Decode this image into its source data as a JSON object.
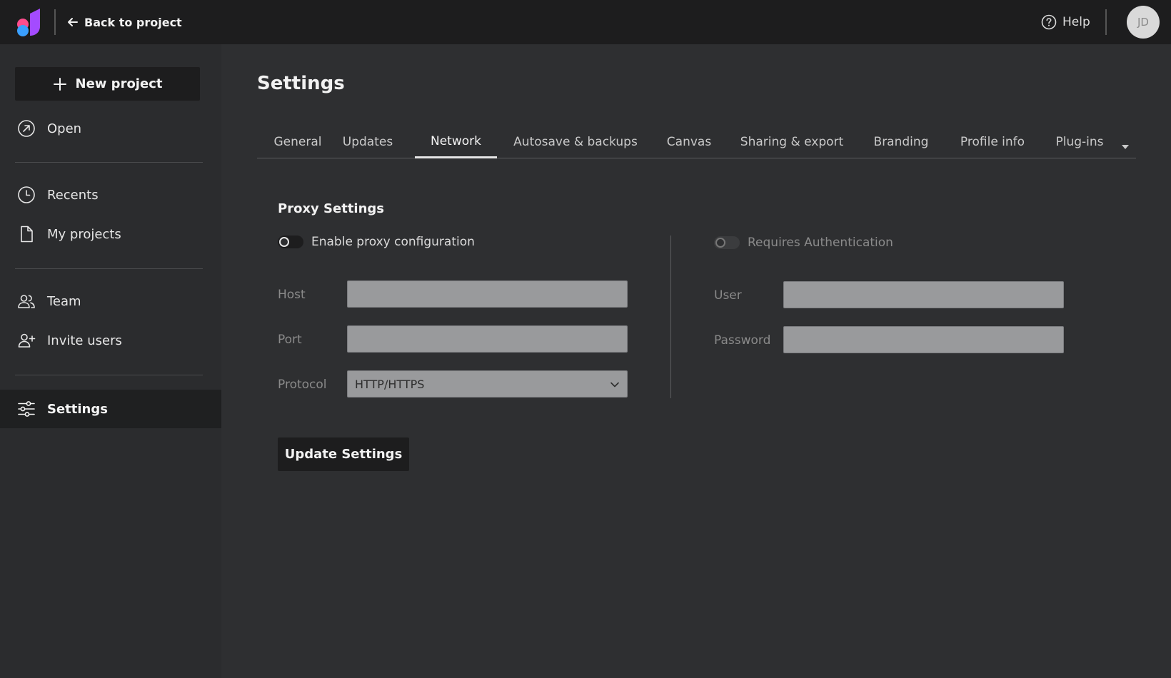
{
  "topbar": {
    "back_label": "Back to project",
    "help_label": "Help",
    "avatar_initials": "JD"
  },
  "sidebar": {
    "new_project_label": "New project",
    "items": [
      {
        "label": "Open",
        "icon": "open-arrow-icon"
      },
      {
        "label": "Recents",
        "icon": "clock-icon"
      },
      {
        "label": "My projects",
        "icon": "file-icon"
      },
      {
        "label": "Team",
        "icon": "team-icon"
      },
      {
        "label": "Invite users",
        "icon": "add-user-icon"
      },
      {
        "label": "Settings",
        "icon": "sliders-icon",
        "active": true
      }
    ]
  },
  "main": {
    "title": "Settings",
    "tabs": [
      {
        "label": "General"
      },
      {
        "label": "Updates"
      },
      {
        "label": "Network",
        "active": true
      },
      {
        "label": "Autosave & backups"
      },
      {
        "label": "Canvas"
      },
      {
        "label": "Sharing & export"
      },
      {
        "label": "Branding"
      },
      {
        "label": "Profile info"
      },
      {
        "label": "Plug-ins"
      }
    ],
    "proxy": {
      "section_title": "Proxy Settings",
      "enable_label": "Enable proxy configuration",
      "enable_on": false,
      "auth_label": "Requires Authentication",
      "auth_on": false,
      "host_label": "Host",
      "host_value": "",
      "port_label": "Port",
      "port_value": "",
      "protocol_label": "Protocol",
      "protocol_value": "HTTP/HTTPS",
      "user_label": "User",
      "user_value": "",
      "password_label": "Password",
      "password_value": ""
    },
    "update_button_label": "Update Settings"
  },
  "colors": {
    "background": "#2e2f31",
    "topbar": "#1d1d1e",
    "sidebar": "#2b2c2e",
    "input": "#999a9c",
    "logo_pink": "#ff4d8d",
    "logo_blue": "#3aa0ff",
    "logo_purple": "#a44bff"
  }
}
